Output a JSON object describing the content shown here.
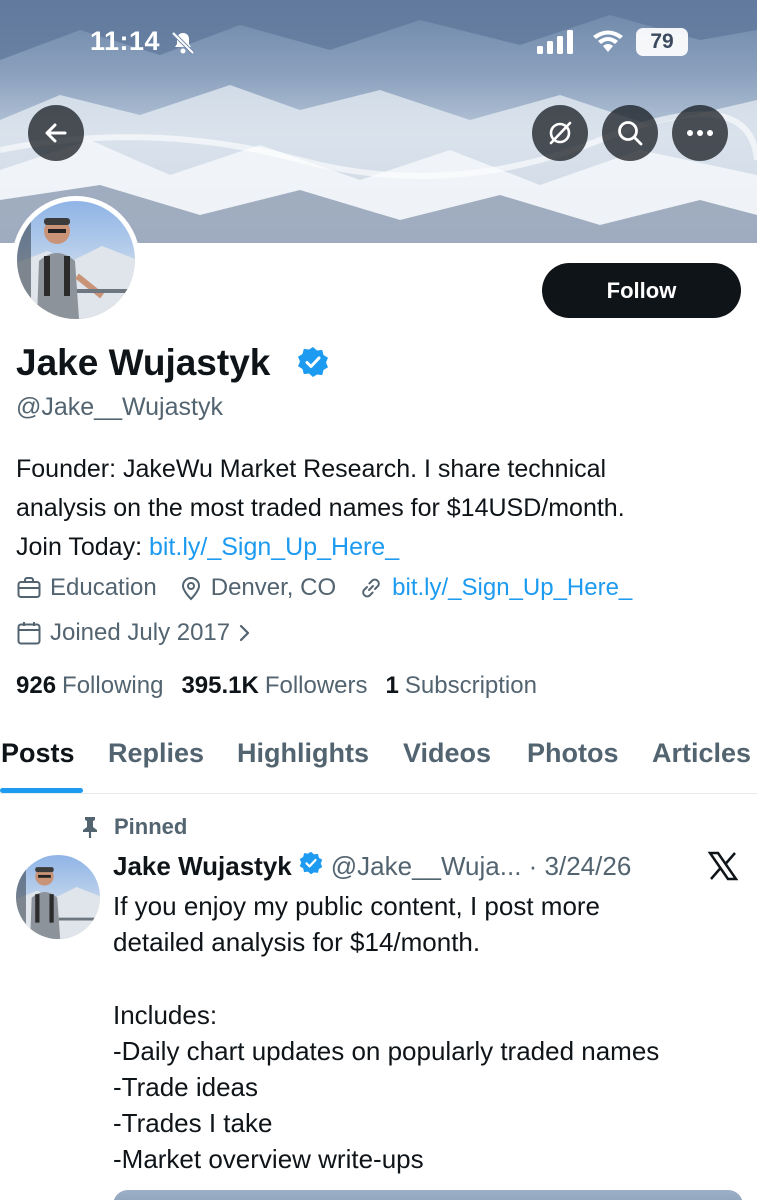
{
  "status_bar": {
    "time": "11:14",
    "battery": "79"
  },
  "header": {
    "back_icon": "back-arrow-icon",
    "actions": [
      "grok-icon",
      "search-icon",
      "more-icon"
    ]
  },
  "profile": {
    "follow_label": "Follow",
    "name": "Jake Wujastyk",
    "handle": "@Jake__Wujastyk",
    "bio_lines": [
      "Founder: JakeWu Market Research. I share technical",
      "analysis on the most traded names for $14USD/month.",
      "Join Today: "
    ],
    "bio_link": "bit.ly/_Sign_Up_Here_",
    "category": "Education",
    "location": "Denver, CO",
    "website": "bit.ly/_Sign_Up_Here_",
    "joined": "Joined July 2017",
    "following_count": "926",
    "following_label": "Following",
    "followers_count": "395.1K",
    "followers_label": "Followers",
    "subscription_count": "1",
    "subscription_label": "Subscription"
  },
  "tabs": [
    "Posts",
    "Replies",
    "Highlights",
    "Videos",
    "Photos",
    "Articles"
  ],
  "pinned_tweet": {
    "pinned_label": "Pinned",
    "name": "Jake Wujastyk",
    "handle_date": "@Jake__Wuja... · 3/24/26",
    "lines": [
      "If you enjoy my public content, I post more",
      "detailed analysis for $14/month.",
      "",
      "Includes:",
      "-Daily chart updates on popularly traded names",
      "-Trade ideas",
      "-Trades I take",
      "-Market overview write-ups"
    ]
  },
  "colors": {
    "accent": "#1d9bf0",
    "text": "#0f1419",
    "secondary": "#536471"
  }
}
